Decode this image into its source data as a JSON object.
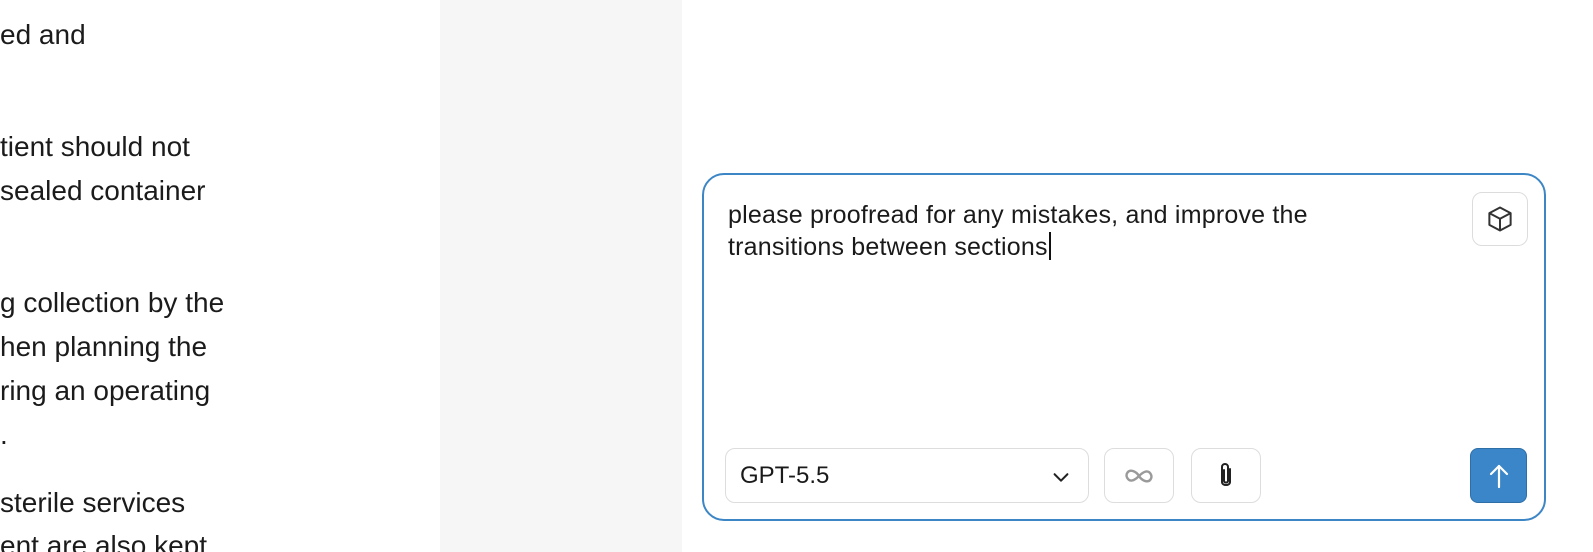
{
  "document": {
    "lines": [
      "ed and",
      "tient should not",
      "sealed container",
      "g collection by the",
      "hen planning the",
      "ring an operating",
      ".",
      "sterile services",
      "ent are also kept"
    ]
  },
  "composer": {
    "prompt_text": "please proofread for any mistakes, and improve the transitions between sections",
    "model_selected": "GPT-5.5",
    "cube_icon": "cube-icon",
    "infinity_icon": "infinity-icon",
    "attach_icon": "paperclip-icon",
    "send_icon": "arrow-up-icon",
    "accent_color": "#3b86c8"
  }
}
